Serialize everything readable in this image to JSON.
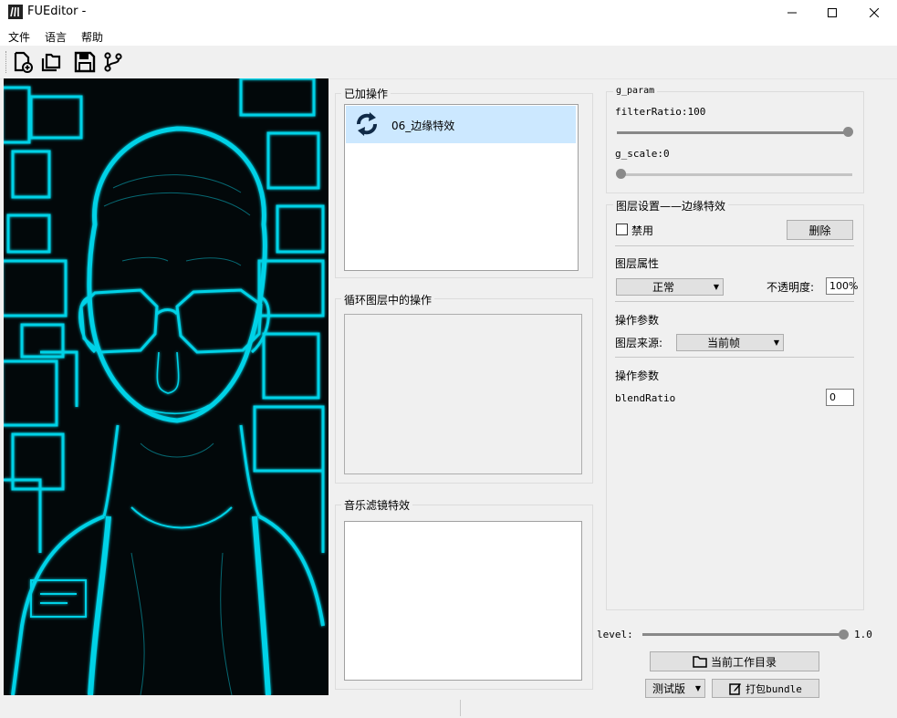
{
  "window": {
    "title": "FUEditor -"
  },
  "menu": [
    "文件",
    "语言",
    "帮助"
  ],
  "toolbar": {
    "icons": [
      "new-file-icon",
      "open-folder-icon",
      "save-icon",
      "branch-icon"
    ]
  },
  "ops_panel": {
    "title": "已加操作",
    "items": [
      {
        "label": "06_边缘特效",
        "icon": "refresh-icon"
      }
    ]
  },
  "loop_panel": {
    "title": "循环图层中的操作"
  },
  "music_panel": {
    "title": "音乐滤镜特效"
  },
  "params": {
    "group_title": "g_param",
    "filter_ratio": {
      "label": "filterRatio:100",
      "value": 100,
      "fraction": 1.0
    },
    "g_scale": {
      "label": "g_scale:0",
      "value": 0,
      "fraction": 0.0
    }
  },
  "layer": {
    "group_title": "图层设置——边缘特效",
    "disable_label": "禁用",
    "disabled": false,
    "delete_label": "删除",
    "props_title": "图层属性",
    "blend_mode": "正常",
    "opacity_label": "不透明度:",
    "opacity_value": "100%",
    "op_params_title": "操作参数",
    "source_label": "图层来源:",
    "source_value": "当前帧",
    "op_params_title2": "操作参数",
    "blend_ratio_label": "blendRatio",
    "blend_ratio_value": "0"
  },
  "level": {
    "label": "level:",
    "value": "1.0",
    "fraction": 1.0
  },
  "buttons": {
    "workdir": "当前工作目录",
    "version": "测试版",
    "pack": "打包bundle"
  },
  "colors": {
    "selection": "#cce8ff",
    "accent": "#00e5ff"
  }
}
